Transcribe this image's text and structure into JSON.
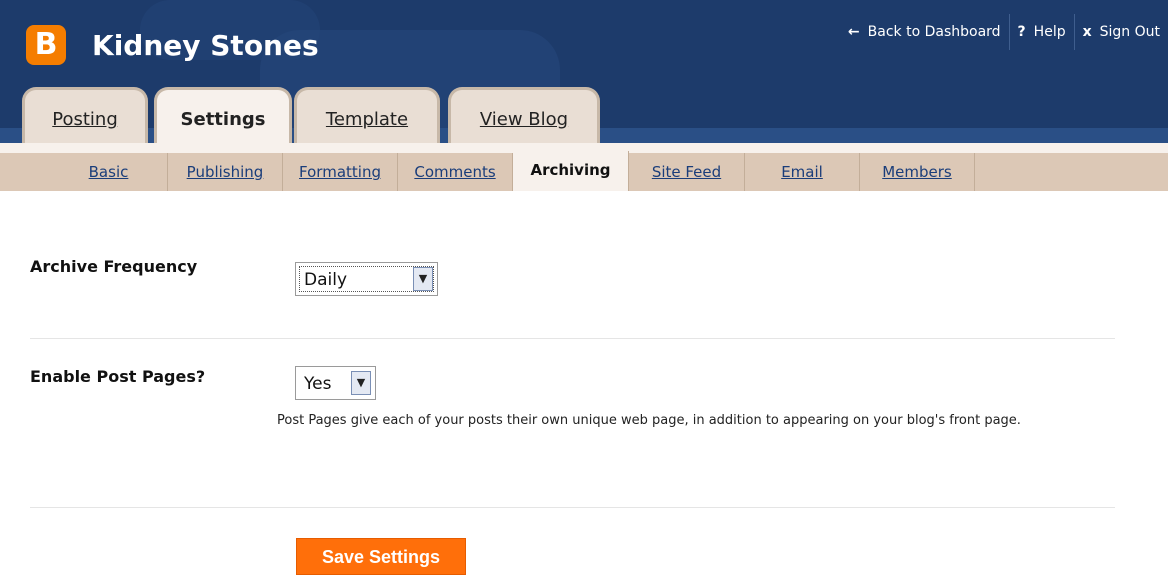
{
  "header": {
    "logo_letter": "B",
    "blog_title": "Kidney Stones",
    "nav": {
      "back_glyph": "←",
      "back_label": "Back to Dashboard",
      "help_glyph": "?",
      "help_label": "Help",
      "signout_glyph": "x",
      "signout_label": "Sign Out"
    }
  },
  "tabs": {
    "posting": "Posting",
    "settings": "Settings",
    "template": "Template",
    "view_blog": "View Blog",
    "active": "Settings"
  },
  "subtabs": {
    "basic": "Basic",
    "publishing": "Publishing",
    "formatting": "Formatting",
    "comments": "Comments",
    "archiving": "Archiving",
    "site_feed": "Site Feed",
    "email": "Email",
    "members": "Members",
    "active": "Archiving"
  },
  "form": {
    "archive_frequency": {
      "label": "Archive Frequency",
      "value": "Daily"
    },
    "post_pages": {
      "label": "Enable Post Pages?",
      "value": "Yes",
      "help": "Post Pages give each of your posts their own unique web page, in addition to appearing on your blog's front page."
    },
    "save_label": "Save Settings"
  },
  "colors": {
    "header_bg": "#1d3b6b",
    "brand_orange": "#ff6f0a",
    "tab_bg": "#e9ded4",
    "subbar_bg": "#dcc8b6",
    "link_blue": "#1a3d7a"
  },
  "icons": {
    "logo": "blogger-logo-icon",
    "dropdown": "chevron-down-icon"
  }
}
